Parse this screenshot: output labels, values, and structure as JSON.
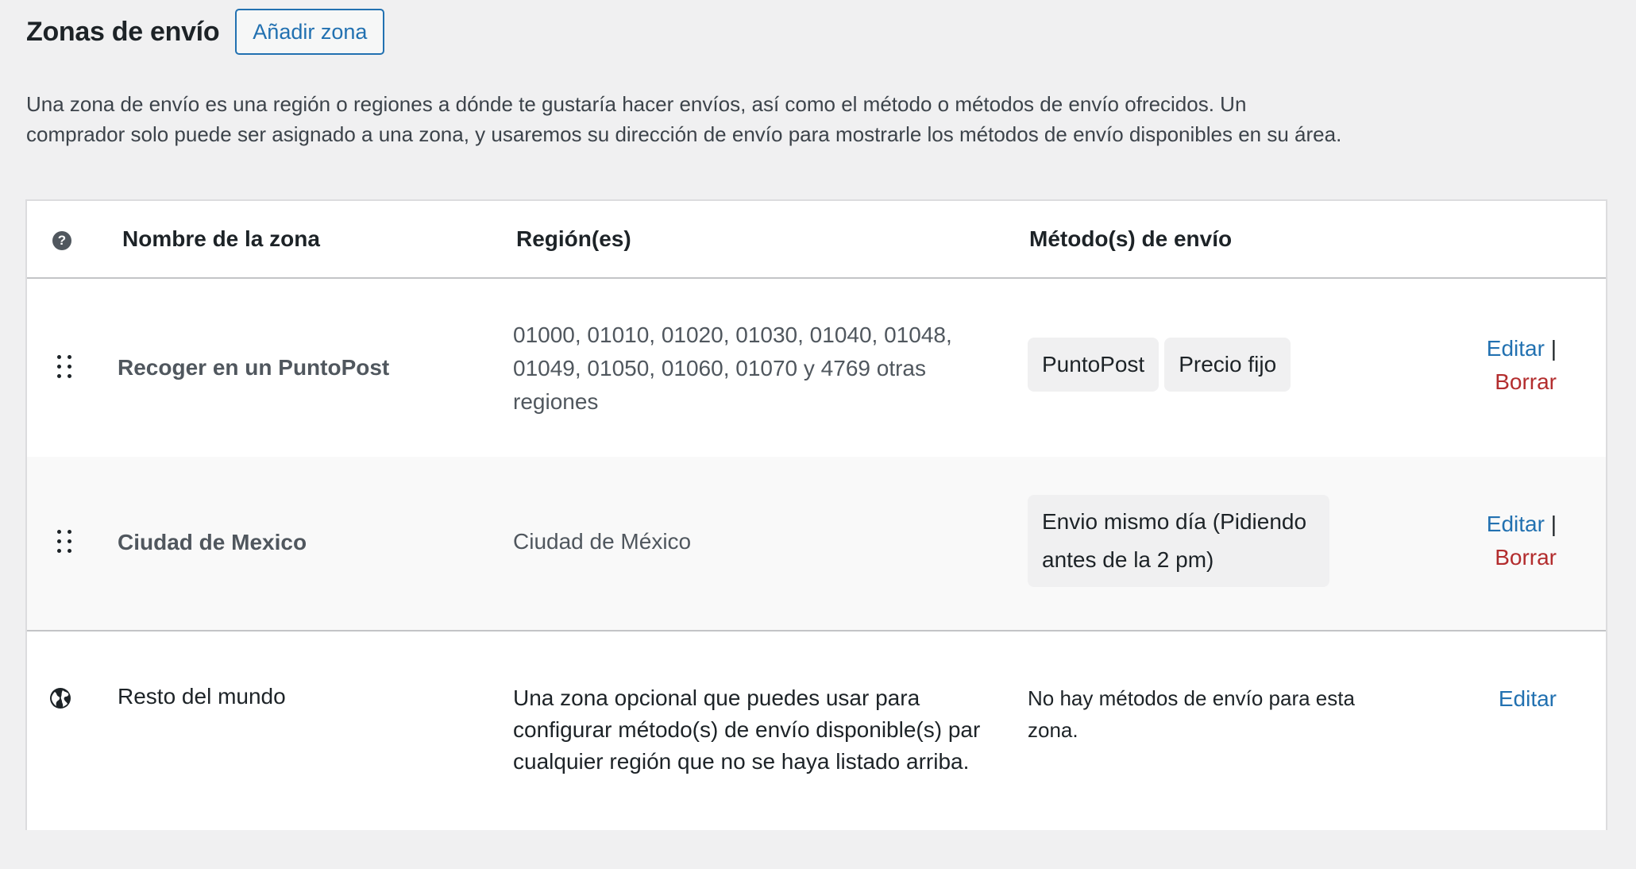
{
  "header": {
    "title": "Zonas de envío",
    "add_button": "Añadir zona"
  },
  "description": "Una zona de envío es una región o regiones a dónde te gustaría hacer envíos, así como el método o métodos de envío ofrecidos. Un comprador solo puede ser asignado a una zona, y usaremos su dirección de envío para mostrarle los métodos de envío disponibles en su área.",
  "table": {
    "columns": {
      "help": "?",
      "zone_name": "Nombre de la zona",
      "regions": "Región(es)",
      "methods": "Método(s) de envío"
    },
    "rows": [
      {
        "name": "Recoger en un PuntoPost",
        "regions": "01000, 01010, 01020, 01030, 01040, 01048, 01049, 01050, 01060, 01070 y 4769 otras regiones",
        "methods": [
          "PuntoPost",
          "Precio fijo"
        ],
        "edit": "Editar",
        "separator": "|",
        "delete": "Borrar"
      },
      {
        "name": "Ciudad de Mexico",
        "regions": "Ciudad de México",
        "methods": [
          "Envio mismo día (Pidiendo antes de la 2 pm)"
        ],
        "edit": "Editar",
        "separator": "|",
        "delete": "Borrar"
      }
    ],
    "rest_of_world": {
      "name": "Resto del mundo",
      "description": "Una zona opcional que puedes usar para configurar método(s) de envío disponible(s) par cualquier región que no se haya listado arriba.",
      "no_methods": "No hay métodos de envío para esta zona.",
      "edit": "Editar"
    }
  },
  "colors": {
    "link": "#2271b1",
    "delete": "#b32d2e",
    "background": "#f0f0f1"
  },
  "icons": {
    "help": "help-icon",
    "drag": "drag-handle-icon",
    "globe": "globe-icon"
  }
}
